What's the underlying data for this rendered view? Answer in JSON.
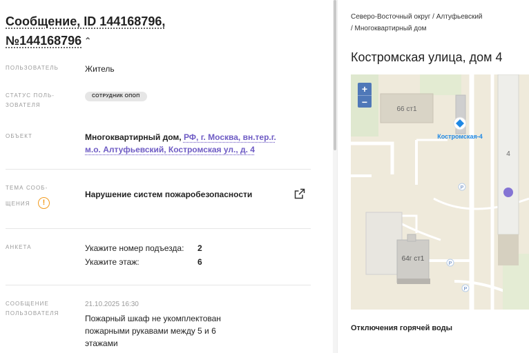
{
  "message": {
    "title_line1": "Сообщение, ID 144168796,",
    "title_line2": "№144168796",
    "chevron": "^"
  },
  "fields": {
    "user_label": "ПОЛЬЗОВАТЕЛЬ",
    "user_value": "Житель",
    "status_label_1": "СТАТУС ПОЛЬ-",
    "status_label_2": "ЗОВАТЕЛЯ",
    "status_badge": "СОТРУДНИК ОПОП",
    "object_label": "ОБЪЕКТ",
    "object_type": "Многоквартирный дом, ",
    "object_address": "РФ, г. Москва, вн.тер.г. м.о. Алтуфьевский, Костромская ул., д. 4",
    "topic_label_1": "ТЕМА СООБ-",
    "topic_label_2": "ЩЕНИЯ",
    "topic_value": "Нарушение систем пожаробезопасности",
    "warn_symbol": "!",
    "survey_label": "АНКЕТА",
    "survey": [
      {
        "question": "Укажите номер подъезда:",
        "answer": "2"
      },
      {
        "question": "Укажите этаж:",
        "answer": "6"
      }
    ],
    "msg_label_1": "СООБЩЕНИЕ",
    "msg_label_2": "ПОЛЬЗОВАТЕЛЯ",
    "msg_date": "21.10.2025 16:30",
    "msg_text": "Пожарный шкаф не укомплектован пожарными рукавами между 5 и 6 этажами"
  },
  "side": {
    "breadcrumb_1": "Северо-Восточный округ / Алтуфьевский",
    "breadcrumb_2": "/ Многоквартирный дом",
    "address": "Костромская улица, дом 4",
    "zoom_in": "+",
    "zoom_out": "−",
    "map_labels": {
      "b1": "66 ст1",
      "b2": "64г ст1",
      "poi": "Костромская-4",
      "b3": "4",
      "p": "P"
    },
    "outages_title": "Отключения горячей воды"
  },
  "colors": {
    "accent": "#6e5bc4",
    "warn": "#f29a1c",
    "map_marker": "#8474d4",
    "map_poi": "#1e88e5"
  }
}
